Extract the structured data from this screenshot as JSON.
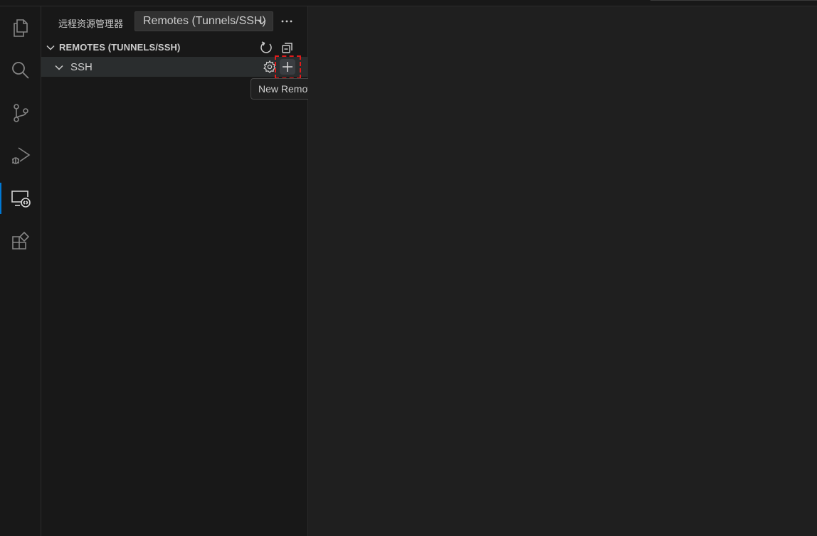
{
  "activity_bar": {
    "items": [
      {
        "name": "explorer",
        "icon": "files-icon"
      },
      {
        "name": "search",
        "icon": "search-icon"
      },
      {
        "name": "source-control",
        "icon": "source-control-icon"
      },
      {
        "name": "run-and-debug",
        "icon": "run-debug-icon"
      },
      {
        "name": "remote-explorer",
        "icon": "remote-explorer-icon",
        "active": true
      },
      {
        "name": "extensions",
        "icon": "extensions-icon"
      }
    ]
  },
  "sidebar": {
    "title": "远程资源管理器",
    "selector": {
      "value": "Remotes (Tunnels/SSH)"
    },
    "more_icon": "ellipsis-icon",
    "section": {
      "title": "REMOTES (TUNNELS/SSH)",
      "actions": [
        {
          "name": "refresh",
          "icon": "refresh-icon"
        },
        {
          "name": "collapse-all",
          "icon": "collapse-all-icon"
        }
      ]
    },
    "tree": {
      "items": [
        {
          "label": "SSH",
          "expanded": true,
          "actions": [
            {
              "name": "configure",
              "icon": "gear-icon"
            },
            {
              "name": "new-remote",
              "icon": "plus-icon"
            }
          ]
        }
      ]
    }
  },
  "tooltip": {
    "text": "New Remote"
  },
  "colors": {
    "accent": "#0078d4",
    "highlight": "#e01b1b",
    "sidebar_bg": "#181818",
    "editor_bg": "#1f1f1f"
  }
}
